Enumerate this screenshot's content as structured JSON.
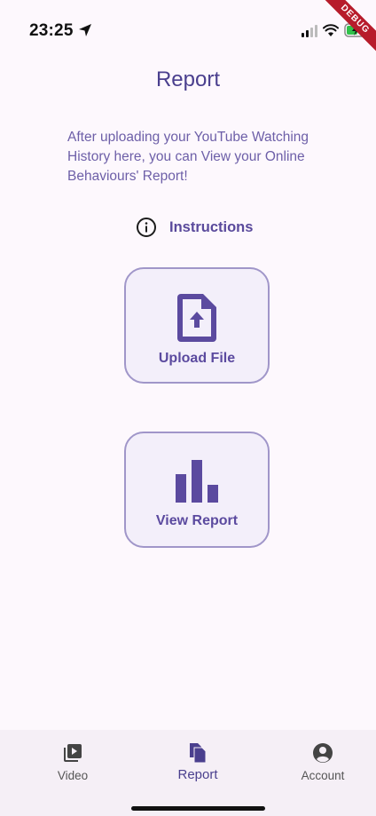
{
  "status_bar": {
    "time": "23:25",
    "icons": [
      "location-arrow-icon",
      "cellular-signal-icon",
      "wifi-icon",
      "battery-charging-icon"
    ]
  },
  "debug_banner": {
    "label": "DEBUG",
    "color": "#b71c2b"
  },
  "page": {
    "title": "Report",
    "intro": "After uploading your YouTube Watching History here, you can View your Online Behaviours' Report!",
    "instructions_label": "Instructions",
    "instructions_icon": "info-circle-icon"
  },
  "actions": {
    "upload": {
      "label": "Upload File",
      "icon": "file-upload-icon"
    },
    "view_report": {
      "label": "View Report",
      "icon": "bar-chart-icon"
    }
  },
  "bottom_nav": {
    "items": [
      {
        "label": "Video",
        "icon": "video-library-icon",
        "active": false
      },
      {
        "label": "Report",
        "icon": "report-copy-icon",
        "active": true
      },
      {
        "label": "Account",
        "icon": "account-circle-icon",
        "active": false
      }
    ]
  },
  "colors": {
    "accent": "#5b4a9f",
    "title": "#4a3f8e",
    "card_border": "#a096c9",
    "card_bg": "#f3effa",
    "background": "#fdf8fd",
    "nav_bg": "#f5eff6"
  }
}
